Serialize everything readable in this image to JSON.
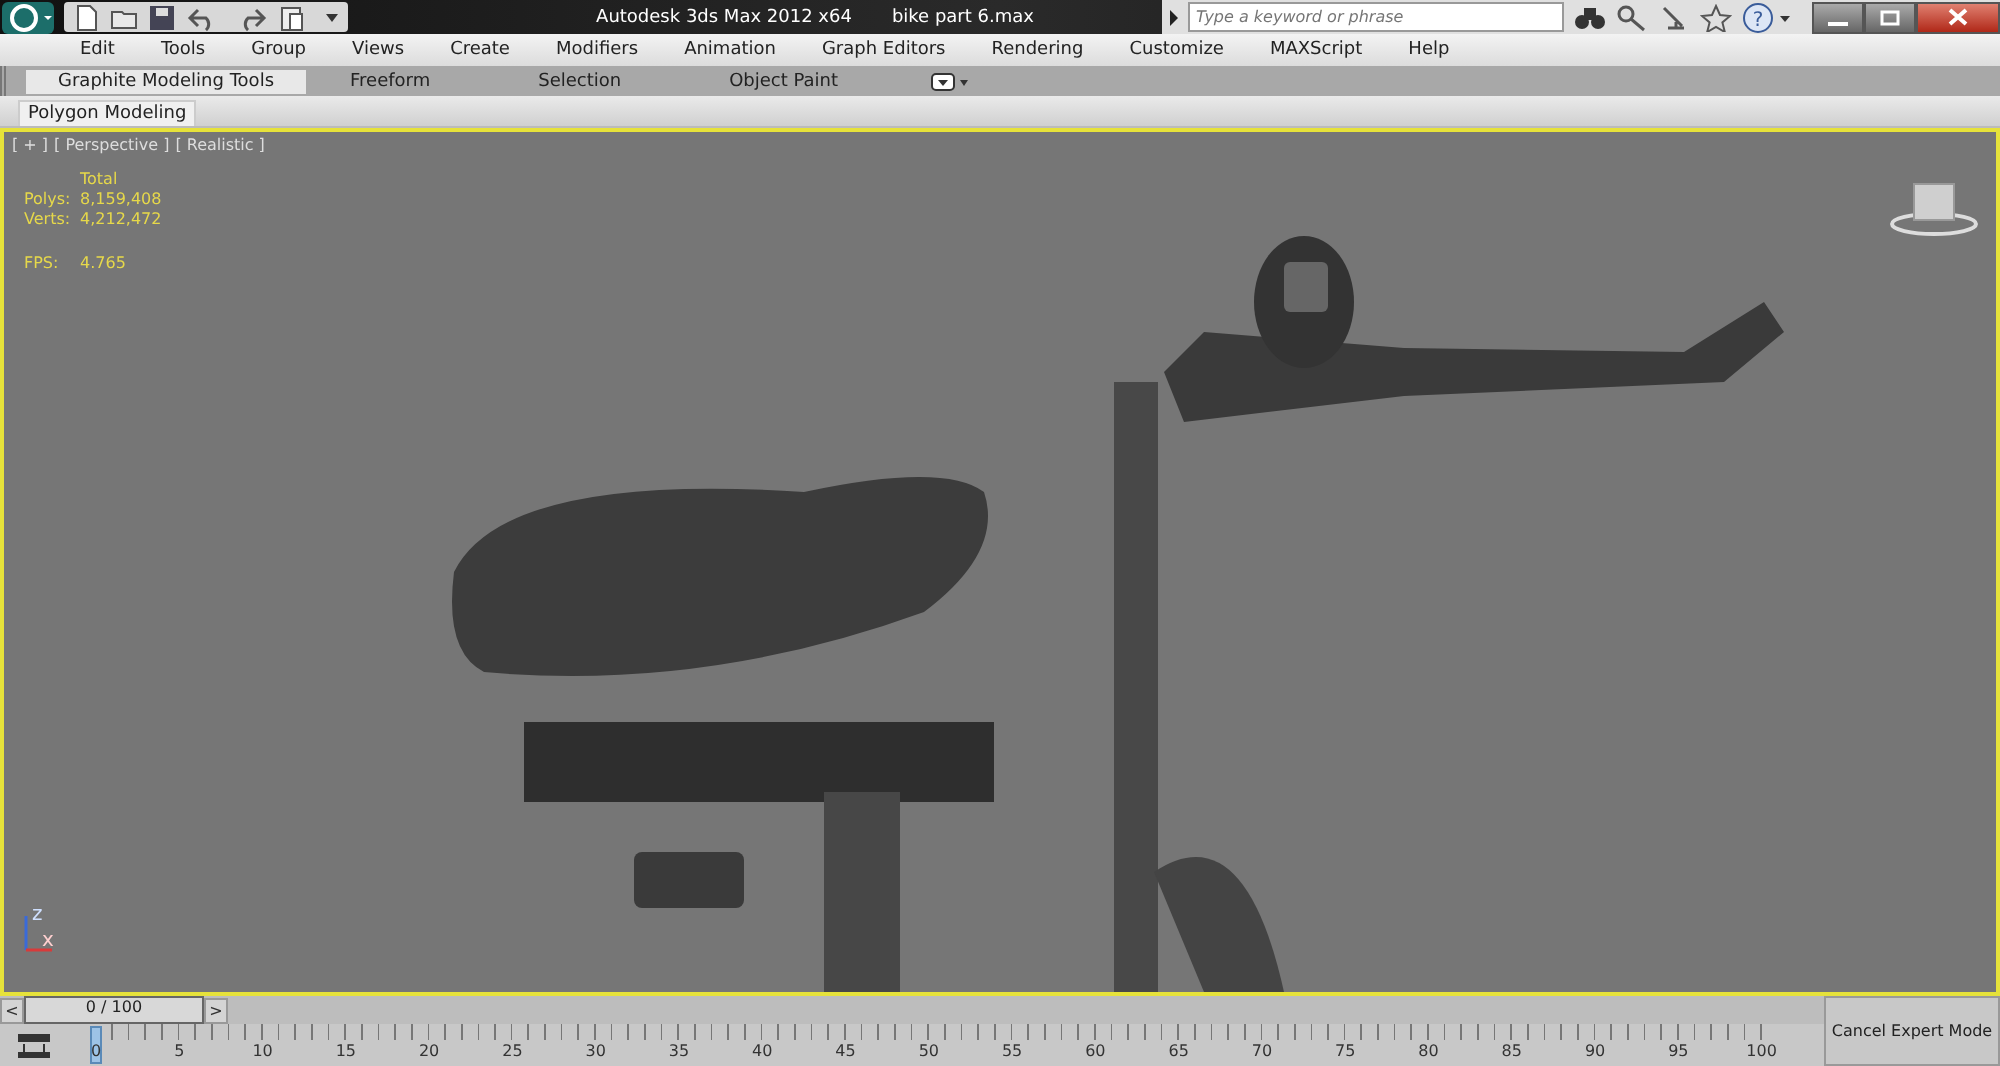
{
  "title_bar": {
    "app_title": "Autodesk 3ds Max  2012 x64",
    "file_name": "bike part 6.max",
    "search": {
      "placeholder": "Type a keyword or phrase"
    },
    "help_glyph": "?"
  },
  "menu": [
    "Edit",
    "Tools",
    "Group",
    "Views",
    "Create",
    "Modifiers",
    "Animation",
    "Graph Editors",
    "Rendering",
    "Customize",
    "MAXScript",
    "Help"
  ],
  "ribbon_tabs": [
    {
      "label": "Graphite Modeling Tools",
      "selected": true
    },
    {
      "label": "Freeform",
      "selected": false
    },
    {
      "label": "Selection",
      "selected": false
    },
    {
      "label": "Object Paint",
      "selected": false
    }
  ],
  "ribbon_panel": "Polygon Modeling",
  "viewport": {
    "labels": [
      "[ + ]",
      "[ Perspective ]",
      "[ Realistic ]"
    ],
    "stats_header": "Total",
    "stats": [
      {
        "label": "Polys:",
        "value": "8,159,408"
      },
      {
        "label": "Verts:",
        "value": "4,212,472"
      }
    ],
    "fps": {
      "label": "FPS:",
      "value": "4.765"
    },
    "axis": {
      "x": "x",
      "z": "z"
    }
  },
  "time_slider": {
    "prev": "<",
    "frame": "0 / 100",
    "next": ">"
  },
  "track_labels": [
    "0",
    "5",
    "10",
    "15",
    "20",
    "25",
    "30",
    "35",
    "40",
    "45",
    "50",
    "55",
    "60",
    "65",
    "70",
    "75",
    "80",
    "85",
    "90",
    "95",
    "100"
  ],
  "cancel_button": "Cancel Expert Mode"
}
